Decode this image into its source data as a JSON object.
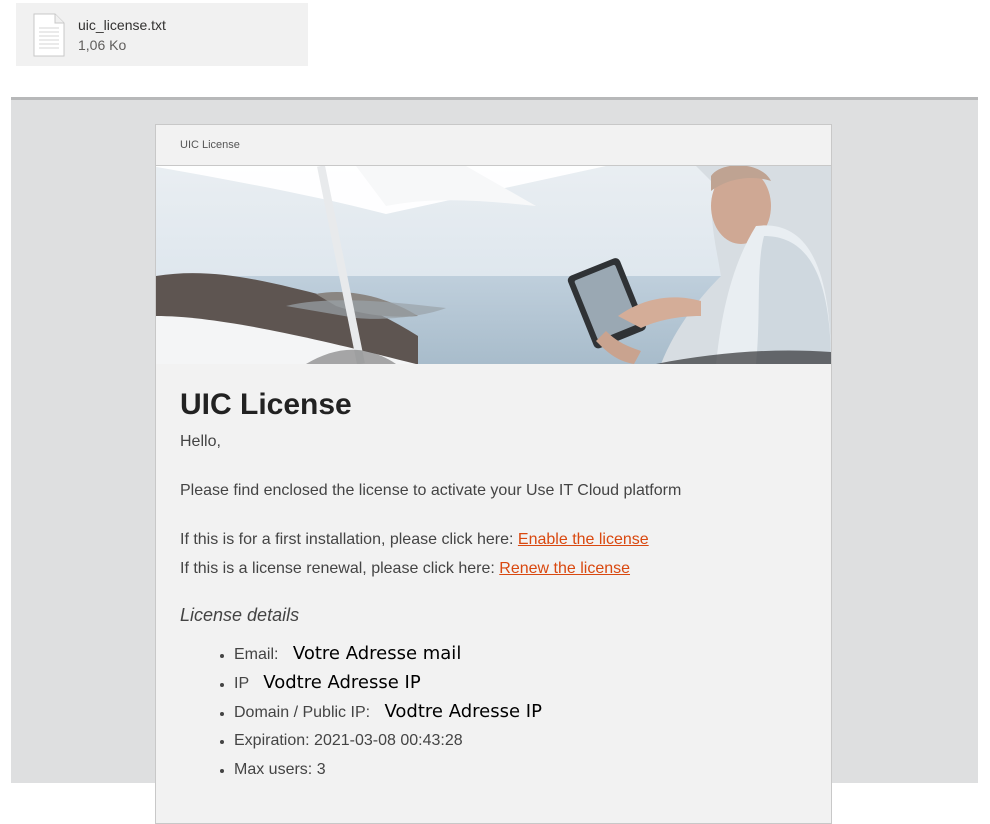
{
  "attachment": {
    "icon": "text-file-icon",
    "name": "uic_license.txt",
    "size": "1,06 Ko"
  },
  "email": {
    "header_label": "UIC License",
    "title": "UIC License",
    "greeting": "Hello,",
    "intro": "Please find enclosed the license to activate your Use IT Cloud platform",
    "first_install_text": "If this is for a first installation, please click here: ",
    "first_install_link": "Enable the license",
    "renewal_text": "If this is a license renewal, please click here: ",
    "renewal_link": "Renew the license",
    "link_color": "#d9480f",
    "details_title": "License details",
    "details": [
      {
        "label": "Email: ",
        "value": "Votre Adresse mail"
      },
      {
        "label": "IP ",
        "value": "Vodtre Adresse IP"
      },
      {
        "label": "Domain / Public IP: ",
        "value": "Vodtre Adresse IP"
      },
      {
        "label": "Expiration: 2021-03-08 00:43:28",
        "value": ""
      },
      {
        "label": "Max users: 3",
        "value": ""
      }
    ]
  }
}
